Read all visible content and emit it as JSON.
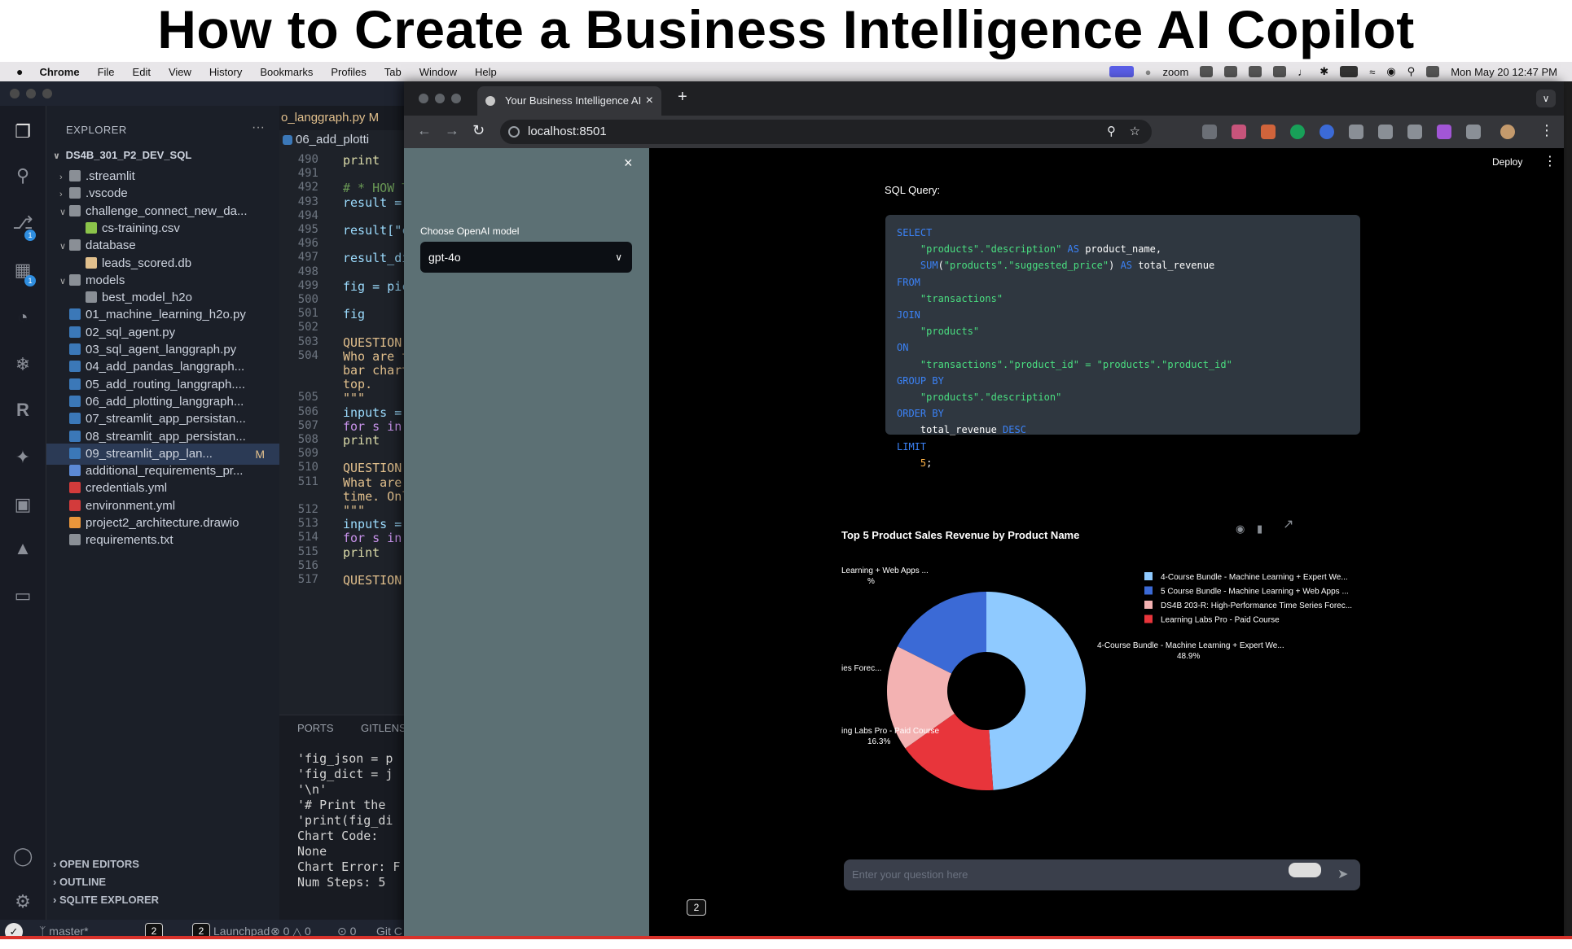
{
  "banner_title": "How to Create a Business Intelligence AI Copilot",
  "menubar": {
    "apple": "",
    "app": "Chrome",
    "items": [
      "File",
      "Edit",
      "View",
      "History",
      "Bookmarks",
      "Profiles",
      "Tab",
      "Window",
      "Help"
    ],
    "zoom": "zoom",
    "datetime": "Mon May 20  12:47 PM"
  },
  "vscode": {
    "explorer_label": "EXPLORER",
    "root": "DS4B_301_P2_DEV_SQL",
    "tree": [
      {
        "label": ".streamlit",
        "kind": "folder",
        "depth": 1,
        "expanded": false
      },
      {
        "label": ".vscode",
        "kind": "folder",
        "depth": 1,
        "expanded": false
      },
      {
        "label": "challenge_connect_new_da...",
        "kind": "folder",
        "depth": 1,
        "expanded": true
      },
      {
        "label": "cs-training.csv",
        "kind": "csv",
        "depth": 2
      },
      {
        "label": "database",
        "kind": "folder",
        "depth": 1,
        "expanded": true
      },
      {
        "label": "leads_scored.db",
        "kind": "db",
        "depth": 2
      },
      {
        "label": "models",
        "kind": "folder",
        "depth": 1,
        "expanded": true
      },
      {
        "label": "best_model_h2o",
        "kind": "file",
        "depth": 2
      },
      {
        "label": "01_machine_learning_h2o.py",
        "kind": "py",
        "depth": 1
      },
      {
        "label": "02_sql_agent.py",
        "kind": "py",
        "depth": 1
      },
      {
        "label": "03_sql_agent_langgraph.py",
        "kind": "py",
        "depth": 1
      },
      {
        "label": "04_add_pandas_langgraph...",
        "kind": "py",
        "depth": 1
      },
      {
        "label": "05_add_routing_langgraph....",
        "kind": "py",
        "depth": 1
      },
      {
        "label": "06_add_plotting_langgraph...",
        "kind": "py",
        "depth": 1
      },
      {
        "label": "07_streamlit_app_persistan...",
        "kind": "py",
        "depth": 1
      },
      {
        "label": "08_streamlit_app_persistan...",
        "kind": "py",
        "depth": 1
      },
      {
        "label": "09_streamlit_app_lan...",
        "kind": "py",
        "depth": 1,
        "selected": true,
        "badge": "M"
      },
      {
        "label": "additional_requirements_pr...",
        "kind": "doc",
        "depth": 1
      },
      {
        "label": "credentials.yml",
        "kind": "yml",
        "depth": 1
      },
      {
        "label": "environment.yml",
        "kind": "yml",
        "depth": 1
      },
      {
        "label": "project2_architecture.drawio",
        "kind": "drawio",
        "depth": 1
      },
      {
        "label": "requirements.txt",
        "kind": "txt",
        "depth": 1
      }
    ],
    "sections": [
      "OPEN EDITORS",
      "OUTLINE",
      "SQLITE EXPLORER"
    ],
    "editor_tab": "o_langgraph.py  M",
    "editor_tab2": "06_add_plotti",
    "lines": [
      {
        "n": "490",
        "t": "    print"
      },
      {
        "n": "491",
        "t": ""
      },
      {
        "n": "492",
        "t": "# * HOW T"
      },
      {
        "n": "493",
        "t": "result ="
      },
      {
        "n": "494",
        "t": ""
      },
      {
        "n": "495",
        "t": "result[\"c"
      },
      {
        "n": "496",
        "t": ""
      },
      {
        "n": "497",
        "t": "result_di"
      },
      {
        "n": "498",
        "t": ""
      },
      {
        "n": "499",
        "t": "fig = pic"
      },
      {
        "n": "500",
        "t": ""
      },
      {
        "n": "501",
        "t": "fig"
      },
      {
        "n": "502",
        "t": ""
      },
      {
        "n": "503",
        "t": "QUESTION"
      },
      {
        "n": "504",
        "t": "Who are t"
      },
      {
        "n": "",
        "t": "bar chart"
      },
      {
        "n": "",
        "t": "top."
      },
      {
        "n": "505",
        "t": "\"\"\""
      },
      {
        "n": "506",
        "t": "inputs ="
      },
      {
        "n": "507",
        "t": "for s in"
      },
      {
        "n": "508",
        "t": "    print"
      },
      {
        "n": "509",
        "t": ""
      },
      {
        "n": "510",
        "t": "QUESTION"
      },
      {
        "n": "511",
        "t": "What are"
      },
      {
        "n": "",
        "t": "time. Onl"
      },
      {
        "n": "512",
        "t": "\"\"\""
      },
      {
        "n": "513",
        "t": "inputs ="
      },
      {
        "n": "514",
        "t": "for s in"
      },
      {
        "n": "515",
        "t": "    print"
      },
      {
        "n": "516",
        "t": ""
      },
      {
        "n": "517",
        "t": "QUESTION"
      }
    ],
    "panel_tabs": [
      "PORTS",
      "GITLENS"
    ],
    "terminal": [
      "'fig_json = p",
      "'fig_dict = j",
      "'\\n'",
      "'# Print the",
      "'print(fig_di",
      "Chart Code:",
      "None",
      "Chart Error: F",
      "Num Steps: 5"
    ],
    "status": {
      "branch": "master*",
      "launchpad": "Launchpad",
      "errors": "0",
      "warnings": "0",
      "ports": "0",
      "git": "Git C",
      "badge": "2"
    }
  },
  "chrome": {
    "tab_title": "Your Business Intelligence AI",
    "url": "localhost:8501"
  },
  "app": {
    "deploy": "Deploy",
    "model_label": "Choose OpenAI model",
    "model_value": "gpt-4o",
    "sql_heading": "SQL Query:",
    "sql_lines": [
      [
        {
          "c": "sk",
          "t": "SELECT"
        }
      ],
      [
        {
          "c": "",
          "t": "    "
        },
        {
          "c": "ss",
          "t": "\"products\".\"description\""
        },
        {
          "c": "sk",
          "t": " AS "
        },
        {
          "c": "",
          "t": "product_name,"
        }
      ],
      [
        {
          "c": "",
          "t": "    "
        },
        {
          "c": "sk",
          "t": "SUM"
        },
        {
          "c": "",
          "t": "("
        },
        {
          "c": "ss",
          "t": "\"products\".\"suggested_price\""
        },
        {
          "c": "",
          "t": ")"
        },
        {
          "c": "sk",
          "t": " AS "
        },
        {
          "c": "",
          "t": "total_revenue"
        }
      ],
      [
        {
          "c": "sk",
          "t": "FROM"
        }
      ],
      [
        {
          "c": "",
          "t": "    "
        },
        {
          "c": "ss",
          "t": "\"transactions\""
        }
      ],
      [
        {
          "c": "sk",
          "t": "JOIN"
        }
      ],
      [
        {
          "c": "",
          "t": "    "
        },
        {
          "c": "ss",
          "t": "\"products\""
        }
      ],
      [
        {
          "c": "sk",
          "t": "ON"
        }
      ],
      [
        {
          "c": "",
          "t": "    "
        },
        {
          "c": "ss",
          "t": "\"transactions\".\"product_id\" = \"products\".\"product_id\""
        }
      ],
      [
        {
          "c": "sk",
          "t": "GROUP BY"
        }
      ],
      [
        {
          "c": "",
          "t": "    "
        },
        {
          "c": "ss",
          "t": "\"products\".\"description\""
        }
      ],
      [
        {
          "c": "sk",
          "t": "ORDER BY"
        }
      ],
      [
        {
          "c": "",
          "t": "    total_revenue "
        },
        {
          "c": "sk",
          "t": "DESC"
        }
      ],
      [
        {
          "c": "sk",
          "t": "LIMIT"
        }
      ],
      [
        {
          "c": "",
          "t": "    "
        },
        {
          "c": "sn",
          "t": "5"
        },
        {
          "c": "",
          "t": ";"
        }
      ]
    ],
    "chat_placeholder": "Enter your question here"
  },
  "chart_data": {
    "type": "pie",
    "hole": true,
    "title": "Top 5 Product Sales Revenue by Product Name",
    "slices": [
      {
        "name": "4-Course Bundle - Machine Learning + Expert We...",
        "value": 48.9,
        "color": "#8fcaff"
      },
      {
        "name": "Learning Labs Pro - Paid Course",
        "value": 16.3,
        "color": "#e8353b"
      },
      {
        "name": "DS4B 203-R: High-Performance Time Series Forec...",
        "value": 17.2,
        "color": "#f3b2b2"
      },
      {
        "name": "5 Course Bundle - Machine Learning + Web Apps ...",
        "value": 17.6,
        "color": "#3b6ad6"
      }
    ],
    "outside_labels": [
      {
        "text": "4-Course Bundle - Machine Learning + Expert We...",
        "pct": "48.9%"
      },
      {
        "text": "ing Labs Pro - Paid Course",
        "pct": "16.3%"
      },
      {
        "text": "ies Forec...",
        "pct": ""
      },
      {
        "text": "Learning + Web Apps ...",
        "pct": "%"
      }
    ],
    "legend": [
      {
        "name": "4-Course Bundle - Machine Learning + Expert We...",
        "color": "#8fcaff"
      },
      {
        "name": "5 Course Bundle - Machine Learning + Web Apps ...",
        "color": "#3b6ad6"
      },
      {
        "name": "DS4B 203-R: High-Performance Time Series Forec...",
        "color": "#f3b2b2"
      },
      {
        "name": "Learning Labs Pro - Paid Course",
        "color": "#e8353b"
      }
    ],
    "legend_position": "right"
  }
}
